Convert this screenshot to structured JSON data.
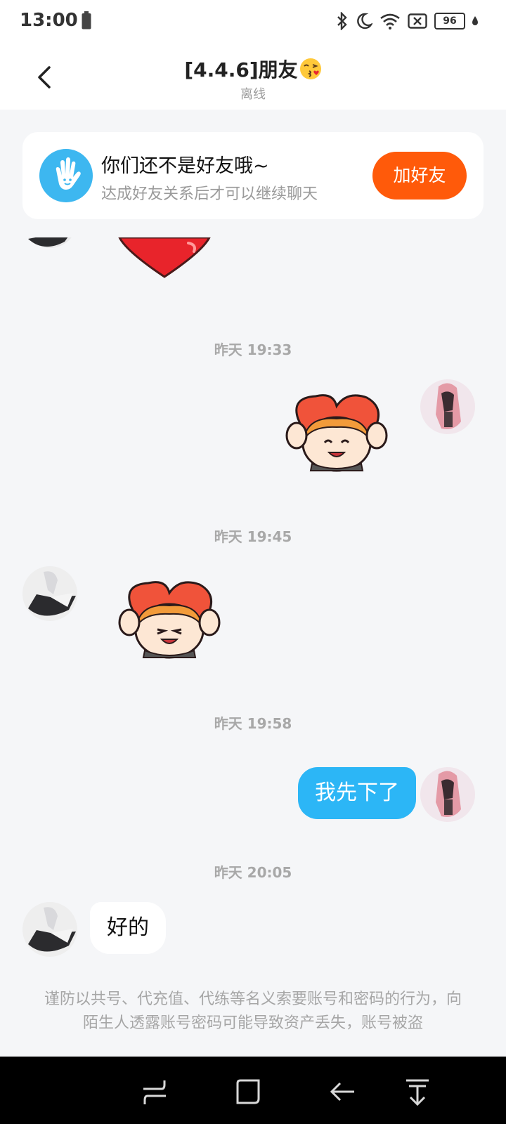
{
  "status_bar": {
    "time": "13:00",
    "battery": "96",
    "icons": [
      "battery-low-icon",
      "bluetooth-icon",
      "moon-icon",
      "wifi-icon",
      "sim-x-icon",
      "battery-icon",
      "charging-icon"
    ]
  },
  "header": {
    "title": "[4.4.6]朋友",
    "title_emoji": "kissing-face-emoji",
    "status": "离线"
  },
  "friend_banner": {
    "title": "你们还不是好友哦~",
    "subtitle": "达成好友关系后才可以继续聊天",
    "button": "加好友"
  },
  "messages": [
    {
      "type": "sticker",
      "side": "left",
      "content": "red-heart-sticker"
    },
    {
      "type": "time",
      "text": "昨天 19:33"
    },
    {
      "type": "sticker",
      "side": "right",
      "content": "girl-holding-heart-sticker"
    },
    {
      "type": "time",
      "text": "昨天 19:45"
    },
    {
      "type": "sticker",
      "side": "left",
      "content": "girl-holding-heart-sticker"
    },
    {
      "type": "time",
      "text": "昨天 19:58"
    },
    {
      "type": "text",
      "side": "right",
      "text": "我先下了"
    },
    {
      "type": "time",
      "text": "昨天 20:05"
    },
    {
      "type": "text",
      "side": "left",
      "text": "好的"
    }
  ],
  "notice": "谨防以共号、代充值、代练等名义索要账号和密码的行为，向陌生人透露账号密码可能导致资产丢失，账号被盗",
  "colors": {
    "accent_orange": "#ff5a0a",
    "bubble_blue": "#2cb6f6",
    "background": "#f5f6f8"
  }
}
